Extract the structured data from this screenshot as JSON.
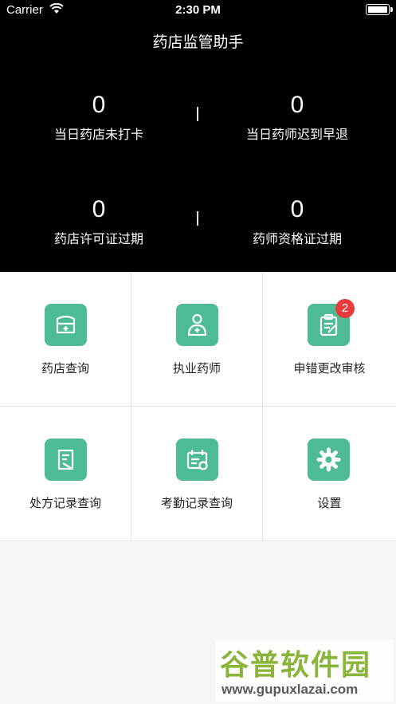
{
  "status_bar": {
    "carrier": "Carrier",
    "time": "2:30 PM"
  },
  "header": {
    "title": "药店监管助手"
  },
  "stats": [
    {
      "value": "0",
      "label": "当日药店未打卡"
    },
    {
      "value": "0",
      "label": "当日药师迟到早退"
    },
    {
      "value": "0",
      "label": "药店许可证过期"
    },
    {
      "value": "0",
      "label": "药师资格证过期"
    }
  ],
  "menu": [
    {
      "label": "药店查询",
      "icon": "pharmacy-icon"
    },
    {
      "label": "执业药师",
      "icon": "pharmacist-icon"
    },
    {
      "label": "申错更改审核",
      "icon": "clipboard-check-icon",
      "badge": "2"
    },
    {
      "label": "处方记录查询",
      "icon": "prescription-icon"
    },
    {
      "label": "考勤记录查询",
      "icon": "attendance-icon"
    },
    {
      "label": "设置",
      "icon": "gear-icon"
    }
  ],
  "watermark": {
    "name": "谷普软件园",
    "url": "www.gupuxlazai.com"
  },
  "colors": {
    "accent": "#4dbb93",
    "header_bg": "#000000",
    "badge": "#e83b3b"
  }
}
